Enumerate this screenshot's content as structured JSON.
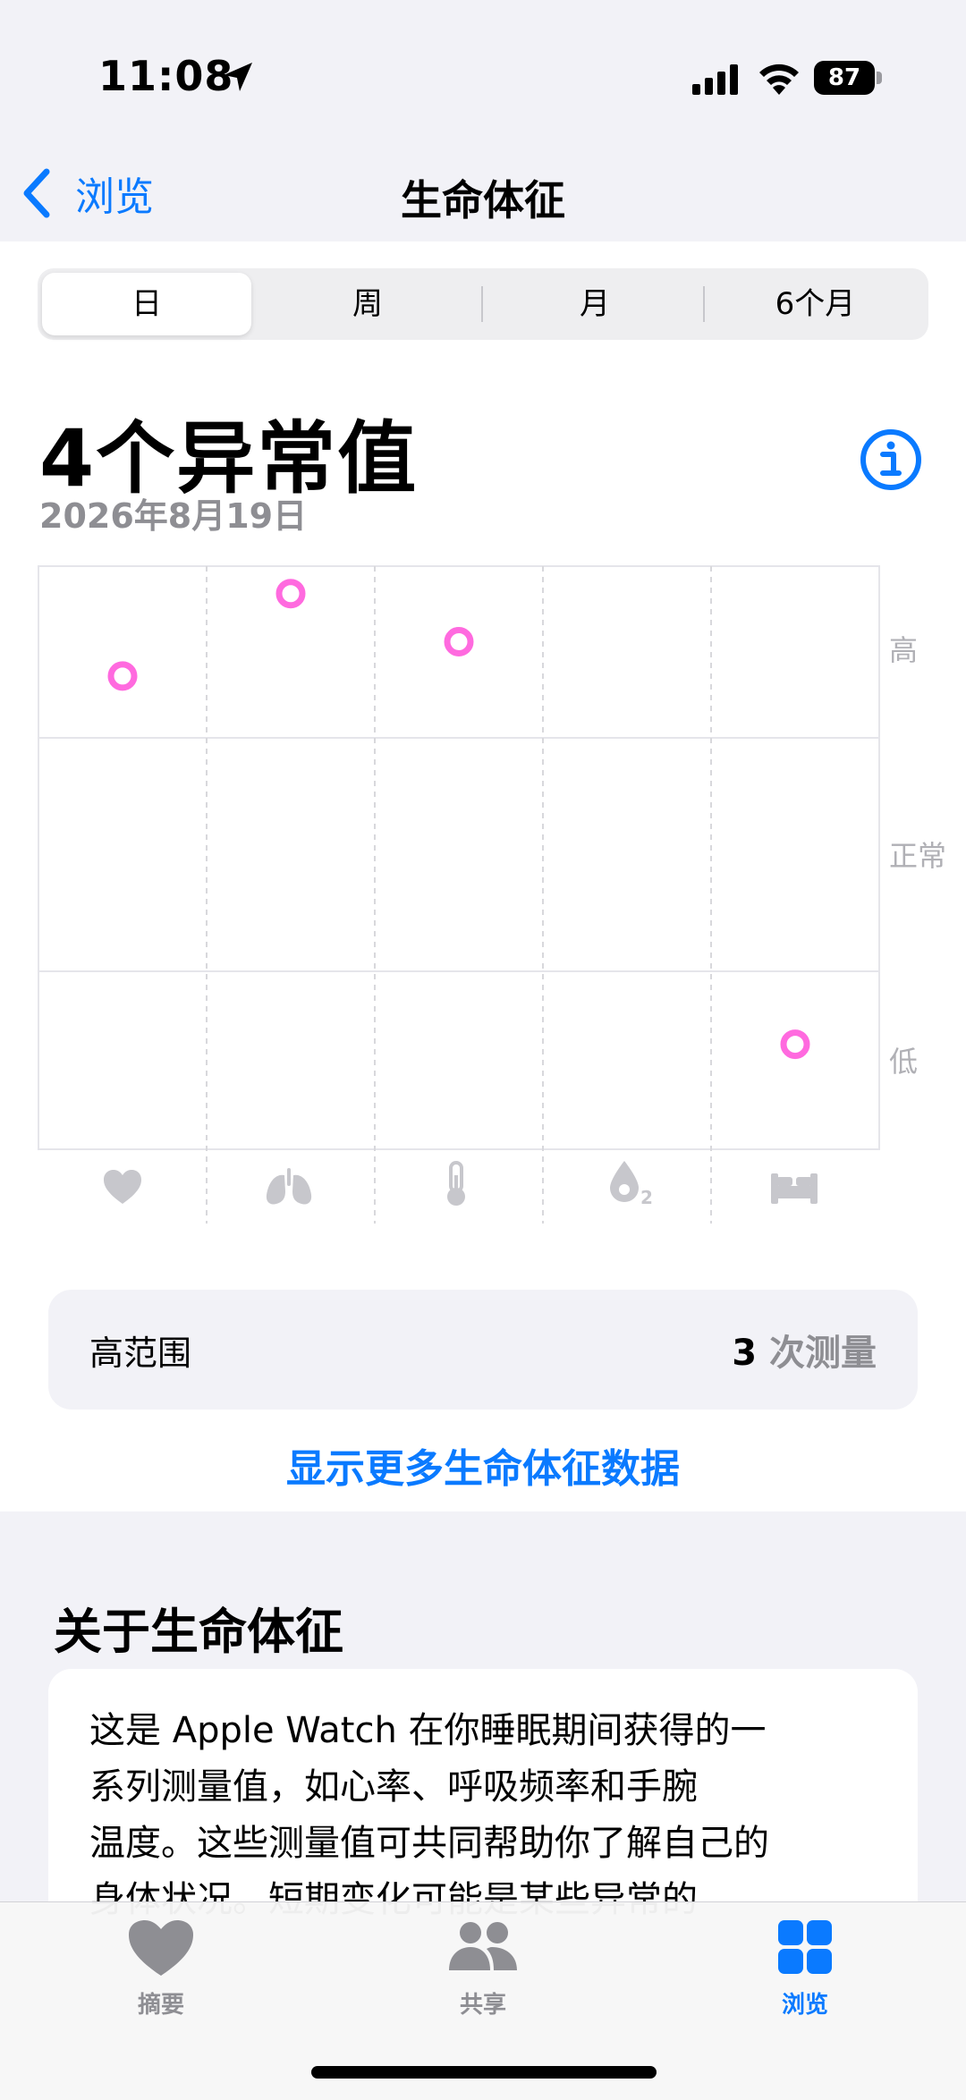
{
  "status_bar": {
    "time": "11:08",
    "battery": "87"
  },
  "nav": {
    "back_label": "浏览",
    "title": "生命体征"
  },
  "segments": [
    "日",
    "周",
    "月",
    "6个月"
  ],
  "summary": {
    "headline": "4个异常值",
    "date": "2026年8月19日"
  },
  "chart_data": {
    "type": "scatter",
    "categories": [
      "heart-icon",
      "lungs-icon",
      "thermometer-icon",
      "blood-oxygen-icon",
      "bed-icon"
    ],
    "y_bands": [
      "高",
      "正常",
      "低"
    ],
    "points": [
      {
        "category": "heart-icon",
        "band": "高"
      },
      {
        "category": "lungs-icon",
        "band": "高"
      },
      {
        "category": "thermometer-icon",
        "band": "高"
      },
      {
        "category": "bed-icon",
        "band": "低"
      }
    ],
    "marker_color": "#ff6adf"
  },
  "range_card": {
    "label": "高范围",
    "count": "3",
    "unit": "次测量"
  },
  "more_link": "显示更多生命体征数据",
  "about": {
    "title": "关于生命体征",
    "lines": [
      "这是 Apple Watch 在你睡眠期间获得的一",
      "系列测量值，如心率、呼吸频率和手腕",
      "温度。这些测量值可共同帮助你了解自己的",
      "身体状况。短期变化可能是某些异常的"
    ]
  },
  "tabs": [
    {
      "label": "摘要",
      "icon": "heart-icon"
    },
    {
      "label": "共享",
      "icon": "people-icon"
    },
    {
      "label": "浏览",
      "icon": "grid-icon"
    }
  ],
  "colors": {
    "accent": "#0a7aff",
    "outlier": "#ff6adf"
  }
}
